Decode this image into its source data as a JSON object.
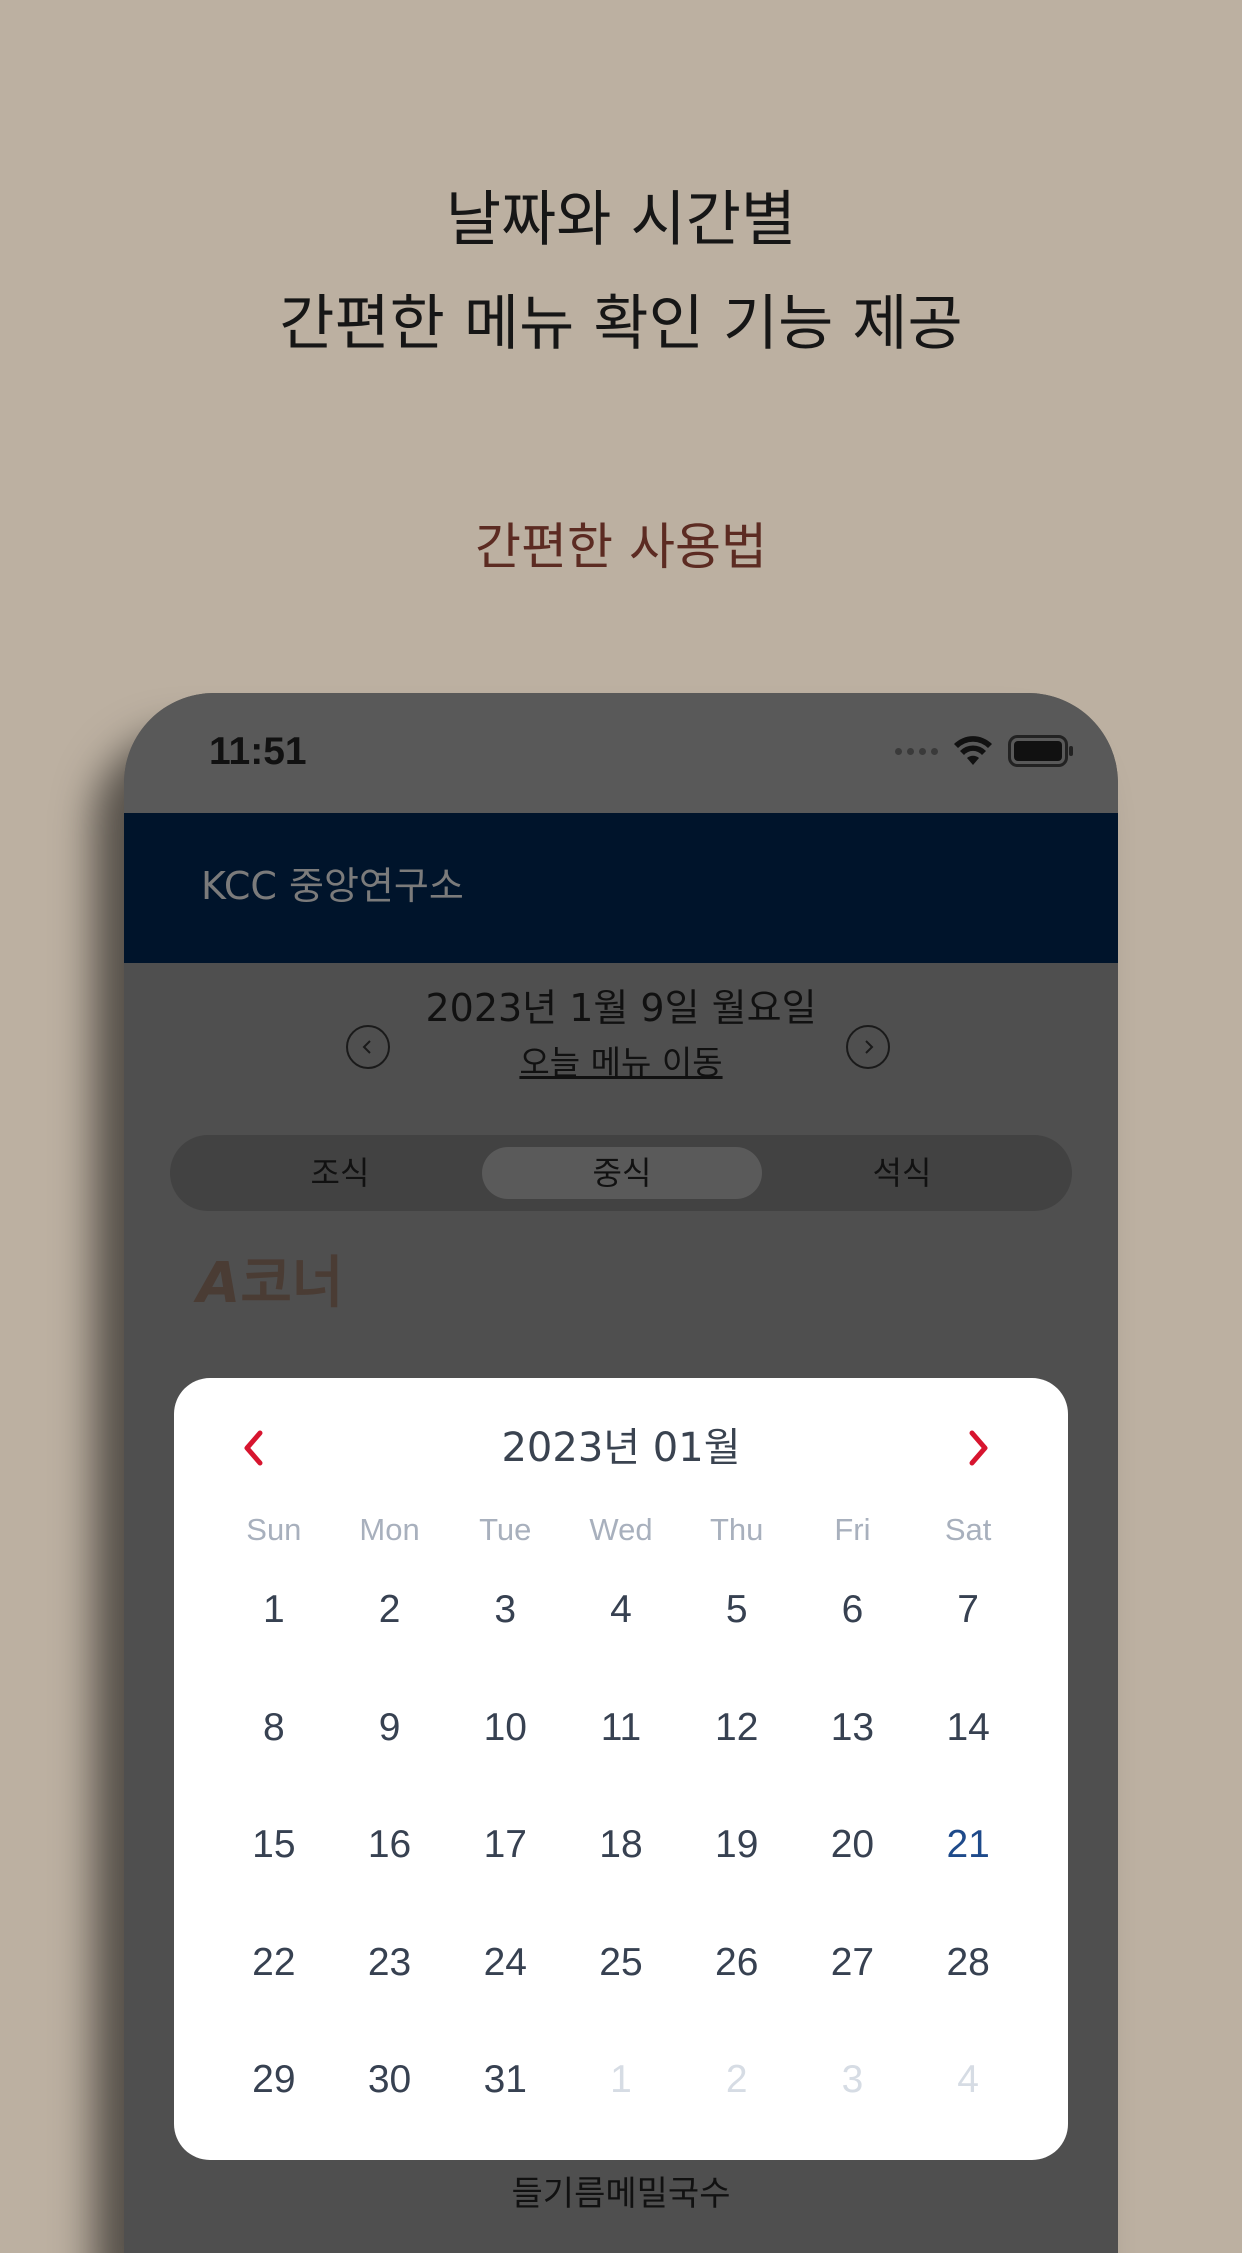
{
  "headline": {
    "line1": "날짜와 시간별",
    "line2": "간편한 메뉴 확인 기능 제공"
  },
  "subhead": "간편한 사용법",
  "status_bar": {
    "time": "11:51",
    "icons": [
      "signal-dots-icon",
      "wifi-icon",
      "battery-icon"
    ]
  },
  "app_bar": {
    "title": "KCC 중앙연구소",
    "background": "#00142b"
  },
  "date_nav": {
    "current_date": "2023년 1월 9일 월요일",
    "today_link": "오늘 메뉴 이동",
    "prev_icon": "chevron-left-icon",
    "next_icon": "chevron-right-icon"
  },
  "meal_tabs": [
    {
      "label": "조식",
      "active": false
    },
    {
      "label": "중식",
      "active": true
    },
    {
      "label": "석식",
      "active": false
    }
  ],
  "corner": {
    "letter": "A",
    "suffix": "코너"
  },
  "dish_partial": "들기름메밀국수",
  "calendar": {
    "title": "2023년 01월",
    "accent_color": "#d7152f",
    "weekdays": [
      "Sun",
      "Mon",
      "Tue",
      "Wed",
      "Thu",
      "Fri",
      "Sat"
    ],
    "days": [
      {
        "label": "1",
        "state": "normal"
      },
      {
        "label": "2",
        "state": "normal"
      },
      {
        "label": "3",
        "state": "normal"
      },
      {
        "label": "4",
        "state": "normal"
      },
      {
        "label": "5",
        "state": "normal"
      },
      {
        "label": "6",
        "state": "normal"
      },
      {
        "label": "7",
        "state": "normal"
      },
      {
        "label": "8",
        "state": "normal"
      },
      {
        "label": "9",
        "state": "normal"
      },
      {
        "label": "10",
        "state": "normal"
      },
      {
        "label": "11",
        "state": "normal"
      },
      {
        "label": "12",
        "state": "normal"
      },
      {
        "label": "13",
        "state": "normal"
      },
      {
        "label": "14",
        "state": "normal"
      },
      {
        "label": "15",
        "state": "normal"
      },
      {
        "label": "16",
        "state": "normal"
      },
      {
        "label": "17",
        "state": "normal"
      },
      {
        "label": "18",
        "state": "normal"
      },
      {
        "label": "19",
        "state": "normal"
      },
      {
        "label": "20",
        "state": "normal"
      },
      {
        "label": "21",
        "state": "highlight"
      },
      {
        "label": "22",
        "state": "normal"
      },
      {
        "label": "23",
        "state": "normal"
      },
      {
        "label": "24",
        "state": "normal"
      },
      {
        "label": "25",
        "state": "normal"
      },
      {
        "label": "26",
        "state": "normal"
      },
      {
        "label": "27",
        "state": "normal"
      },
      {
        "label": "28",
        "state": "normal"
      },
      {
        "label": "29",
        "state": "normal"
      },
      {
        "label": "30",
        "state": "normal"
      },
      {
        "label": "31",
        "state": "normal"
      },
      {
        "label": "1",
        "state": "muted"
      },
      {
        "label": "2",
        "state": "muted"
      },
      {
        "label": "3",
        "state": "muted"
      },
      {
        "label": "4",
        "state": "muted"
      }
    ]
  }
}
